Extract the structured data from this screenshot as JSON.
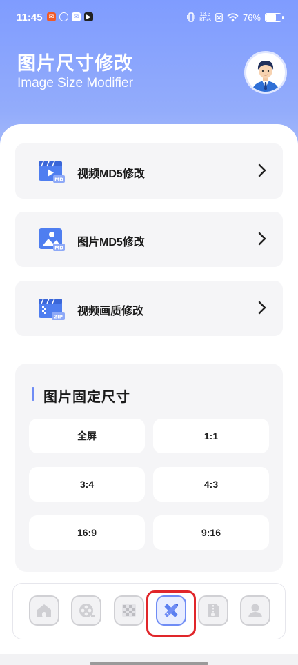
{
  "status_bar": {
    "time": "11:45",
    "net_speed_top": "13.3",
    "net_speed_bottom": "KB/s",
    "battery_text": "76%",
    "battery_level": 0.76
  },
  "header": {
    "title": "图片尺寸修改",
    "subtitle": "Image Size Modifier"
  },
  "menu": [
    {
      "label": "视频MD5修改",
      "icon": "video-md5-icon",
      "badge": "MD"
    },
    {
      "label": "图片MD5修改",
      "icon": "image-md5-icon",
      "badge": "MD"
    },
    {
      "label": "视频画质修改",
      "icon": "video-zip-icon",
      "badge": "ZIP"
    }
  ],
  "fixed_sizes": {
    "title": "图片固定尺寸",
    "options": [
      "全屏",
      "1:1",
      "3:4",
      "4:3",
      "16:9",
      "9:16"
    ]
  },
  "tabbar": {
    "tabs": [
      {
        "icon": "home-icon",
        "active": false
      },
      {
        "icon": "film-reel-icon",
        "active": false
      },
      {
        "icon": "mosaic-icon",
        "active": false
      },
      {
        "icon": "edit-ruler-icon",
        "active": true
      },
      {
        "icon": "zip-file-icon",
        "active": false
      },
      {
        "icon": "user-icon",
        "active": false
      }
    ]
  },
  "colors": {
    "accent": "#6f8cf5",
    "header_top": "#7f9cff",
    "highlight": "#e0262a"
  }
}
